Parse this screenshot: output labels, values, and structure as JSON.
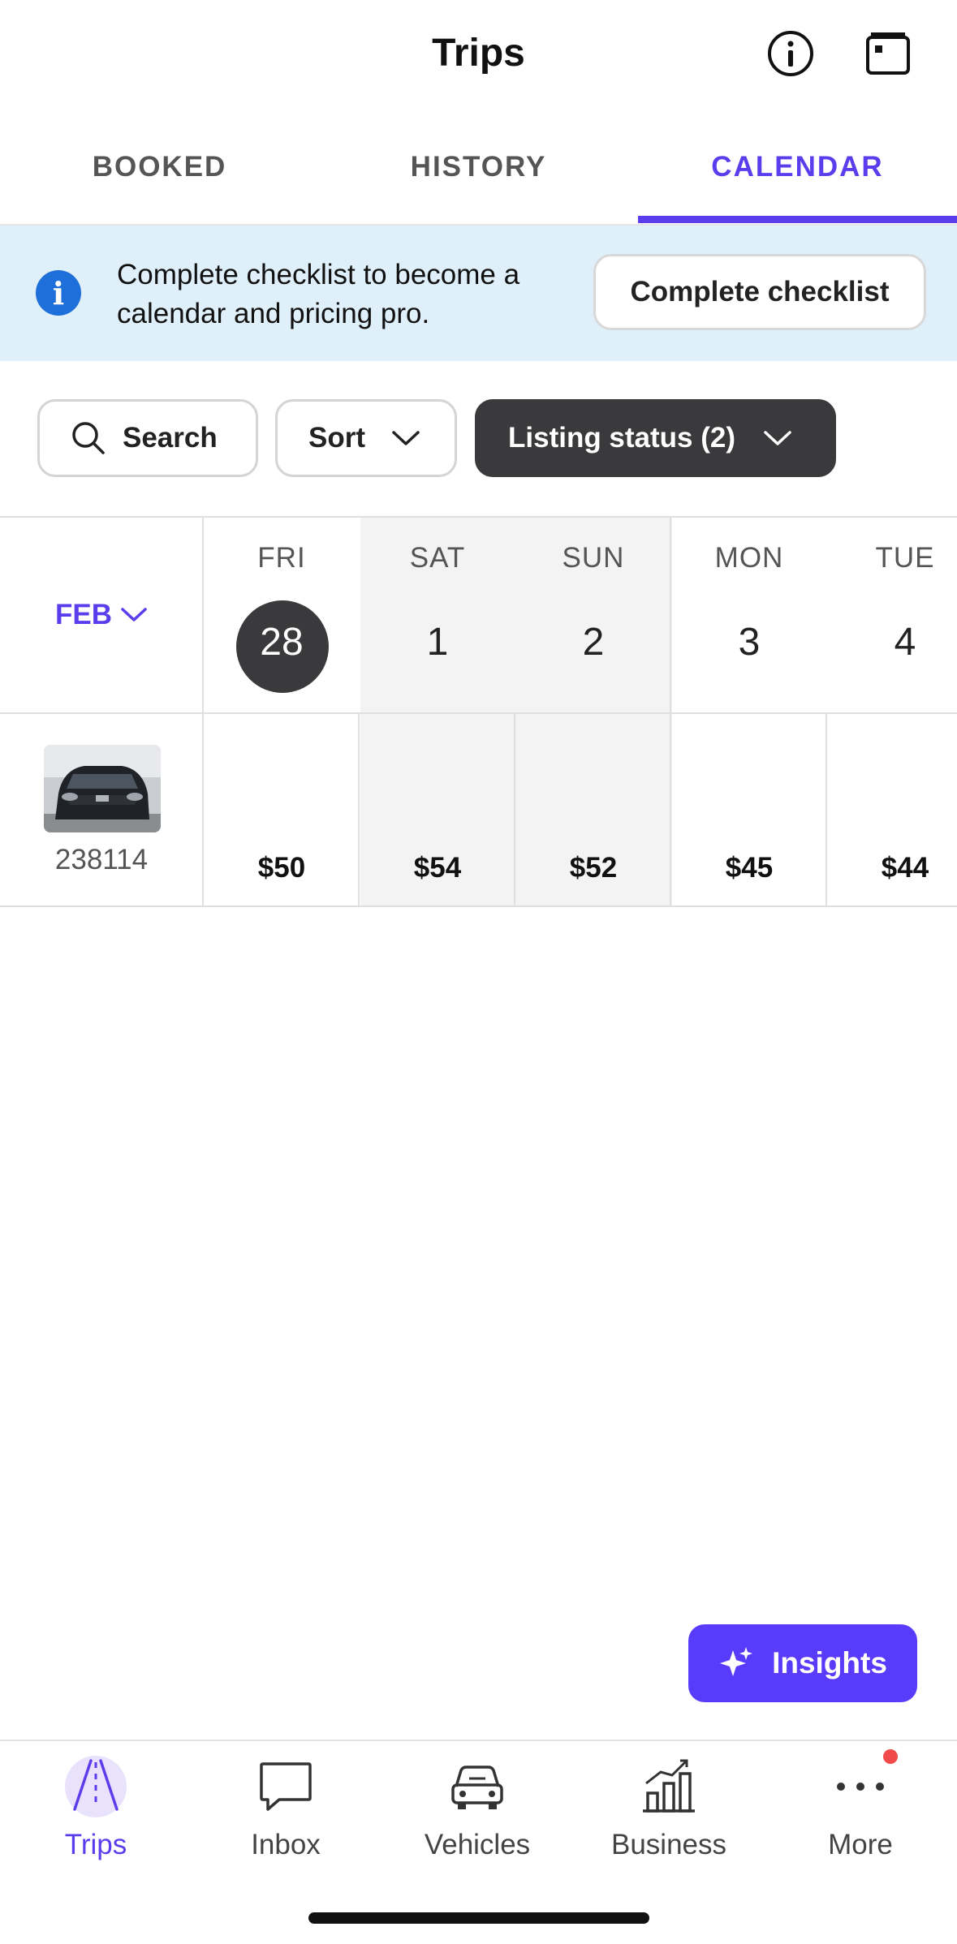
{
  "header": {
    "title": "Trips",
    "icons": [
      "info-icon",
      "wallet-icon"
    ]
  },
  "tabs": [
    {
      "label": "BOOKED",
      "active": false
    },
    {
      "label": "HISTORY",
      "active": false
    },
    {
      "label": "CALENDAR",
      "active": true
    }
  ],
  "banner": {
    "icon": "info-icon",
    "text": "Complete checklist to become a calendar and pricing pro.",
    "button_label": "Complete checklist"
  },
  "filters": {
    "search_label": "Search",
    "sort_label": "Sort",
    "listing_status_label": "Listing status (2)"
  },
  "calendar": {
    "month_label": "FEB",
    "days": [
      {
        "dow": "FRI",
        "date": "28",
        "today": true,
        "weekend": false
      },
      {
        "dow": "SAT",
        "date": "1",
        "today": false,
        "weekend": true
      },
      {
        "dow": "SUN",
        "date": "2",
        "today": false,
        "weekend": true
      },
      {
        "dow": "MON",
        "date": "3",
        "today": false,
        "weekend": false
      },
      {
        "dow": "TUE",
        "date": "4",
        "today": false,
        "weekend": false
      }
    ],
    "listing": {
      "id": "238114",
      "prices": [
        "$50",
        "$54",
        "$52",
        "$45",
        "$44"
      ]
    }
  },
  "insights_label": "Insights",
  "nav": [
    {
      "label": "Trips",
      "icon": "trips-road-icon",
      "active": true
    },
    {
      "label": "Inbox",
      "icon": "chat-bubble-icon",
      "active": false
    },
    {
      "label": "Vehicles",
      "icon": "car-icon",
      "active": false
    },
    {
      "label": "Business",
      "icon": "bar-chart-icon",
      "active": false
    },
    {
      "label": "More",
      "icon": "more-dots-icon",
      "active": false,
      "badge_color": "#f04a4a"
    }
  ],
  "colors": {
    "accent": "#5b3ded",
    "insights": "#593cfb",
    "banner_bg": "#dff0fb",
    "dark_pill": "#3a3a3c"
  }
}
